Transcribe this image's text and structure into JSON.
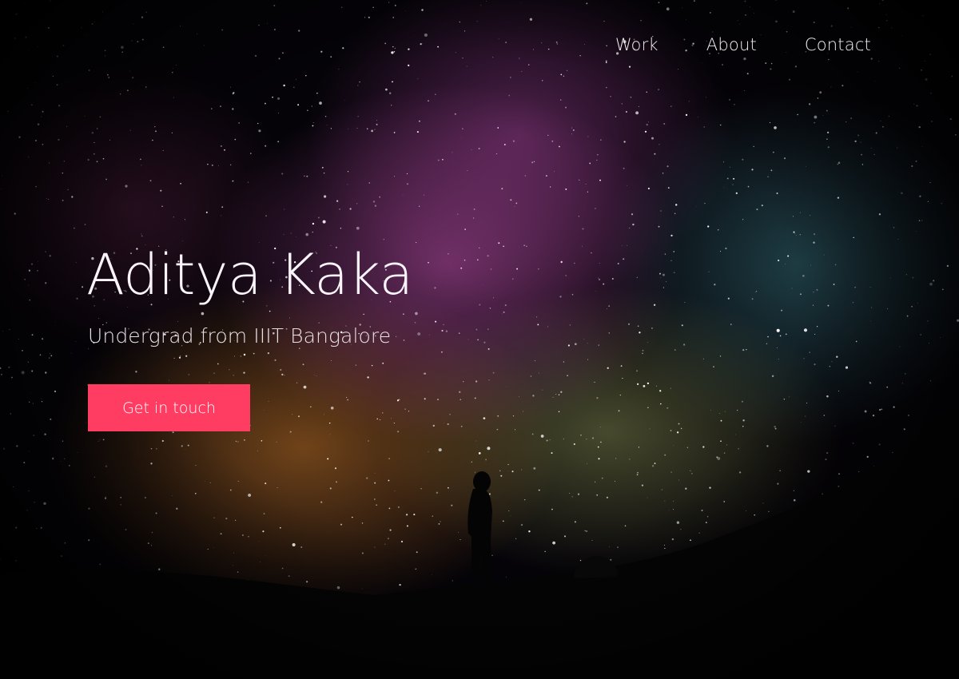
{
  "nav": {
    "items": [
      {
        "label": "Work"
      },
      {
        "label": "About"
      },
      {
        "label": "Contact"
      }
    ]
  },
  "hero": {
    "name": "Aditya Kaka",
    "tagline": "Undergrad from IIIT Bangalore",
    "cta_label": "Get in touch"
  },
  "colors": {
    "accent": "#ff3d63",
    "text": "#f2eef0"
  },
  "background": {
    "image_subject": "milky-way-night-sky-with-silhouette"
  }
}
